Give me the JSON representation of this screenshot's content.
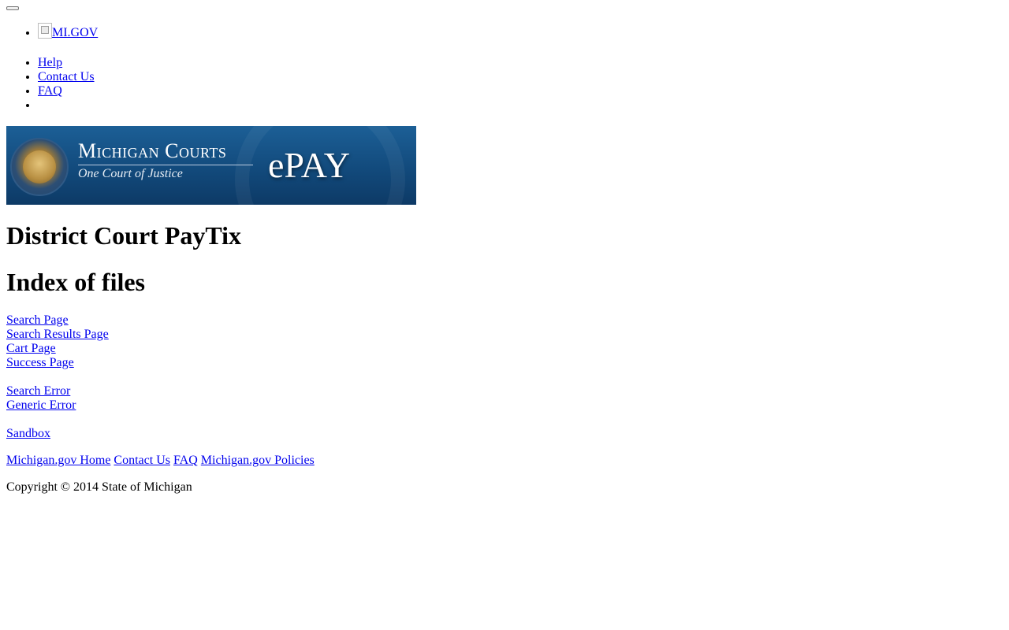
{
  "header": {
    "brand_alt": "MI.GOV",
    "utility_nav": [
      "Help",
      "Contact Us",
      "FAQ",
      ""
    ]
  },
  "banner": {
    "title": "Michigan Courts",
    "subtitle": "One Court of Justice",
    "product": "ePAY"
  },
  "main": {
    "page_title": "District Court PayTix",
    "index_title": "Index of files",
    "page_links": [
      "Search Page",
      "Search Results Page",
      "Cart Page",
      "Success Page"
    ],
    "error_links": [
      "Search Error",
      "Generic Error"
    ],
    "sandbox_link": "Sandbox"
  },
  "footer": {
    "links": [
      "Michigan.gov Home",
      "Contact Us",
      "FAQ",
      "Michigan.gov Policies"
    ],
    "copyright": "Copyright © 2014 State of Michigan"
  },
  "colors": {
    "link": "#0000ee",
    "banner_blue": "#124a7c"
  }
}
